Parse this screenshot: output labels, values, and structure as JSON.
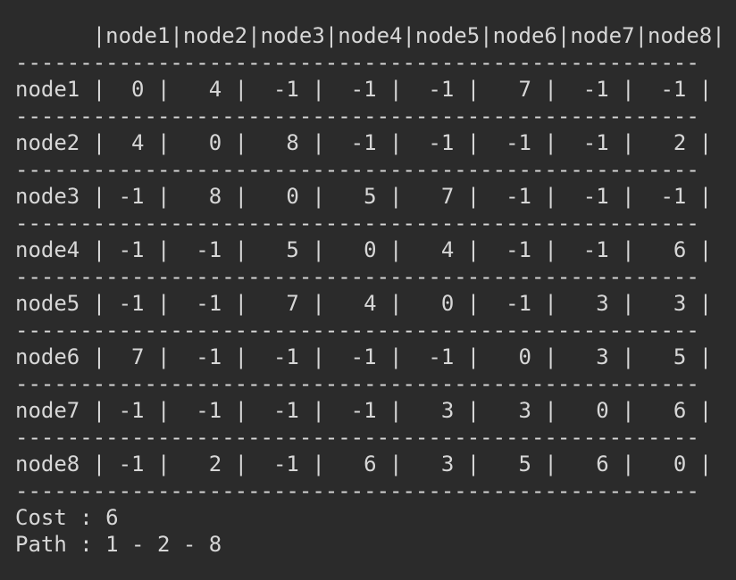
{
  "terminal": {
    "header_line": "      |node1|node2|node3|node4|node5|node6|node7|node8|",
    "separator": "-----------------------------------------------------",
    "rows": [
      "node1 |  0 |   4 |  -1 |  -1 |  -1 |   7 |  -1 |  -1 |",
      "node2 |  4 |   0 |   8 |  -1 |  -1 |  -1 |  -1 |   2 |",
      "node3 | -1 |   8 |   0 |   5 |   7 |  -1 |  -1 |  -1 |",
      "node4 | -1 |  -1 |   5 |   0 |   4 |  -1 |  -1 |   6 |",
      "node5 | -1 |  -1 |   7 |   4 |   0 |  -1 |   3 |   3 |",
      "node6 |  7 |  -1 |  -1 |  -1 |  -1 |   0 |   3 |   5 |",
      "node7 | -1 |  -1 |  -1 |  -1 |   3 |   3 |   0 |   6 |",
      "node8 | -1 |   2 |  -1 |   6 |   3 |   5 |   6 |   0 |"
    ],
    "cost_line": "Cost : 6",
    "path_line": "Path : 1 - 2 - 8"
  }
}
